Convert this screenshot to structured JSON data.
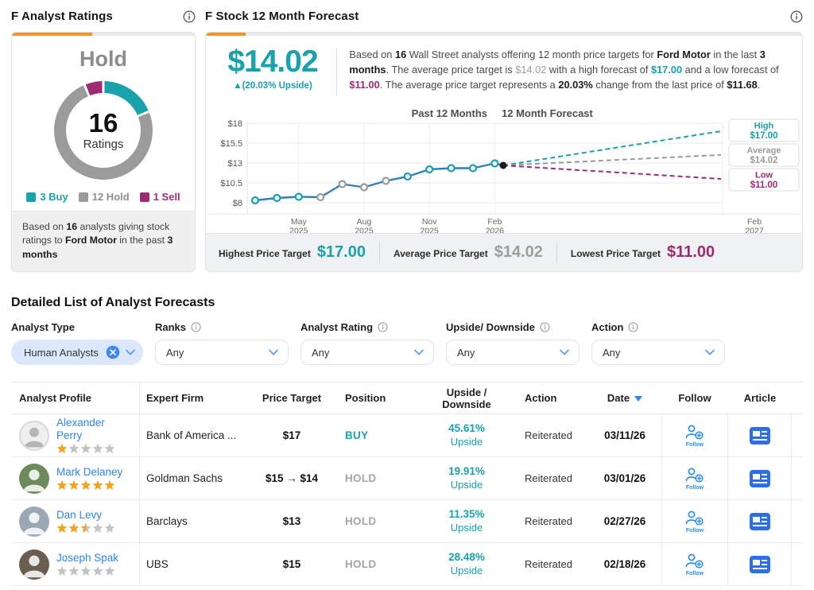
{
  "colors": {
    "teal": "#17a2ac",
    "magenta": "#a02a72",
    "muted": "#9e9e9e",
    "orange": "#f7941e",
    "line_blue": "#2f7fbd",
    "link_blue": "#2e87e5",
    "icon_blue": "#2b8ff0",
    "article_blue": "#2a6fe8",
    "hold_gray": "#9b9b9b"
  },
  "ratings_panel": {
    "title": "F Analyst Ratings",
    "consensus": "Hold",
    "count": "16",
    "count_label": "Ratings",
    "segments": [
      {
        "label": "3 Buy",
        "count": 3,
        "color": "#17a2ac",
        "text_color": "#17a2ac"
      },
      {
        "label": "12 Hold",
        "count": 12,
        "color": "#9b9b9b",
        "text_color": "#8e8e8e"
      },
      {
        "label": "1 Sell",
        "count": 1,
        "color": "#a02a72",
        "text_color": "#a02a72"
      }
    ],
    "footnote": [
      {
        "t": "Based on "
      },
      {
        "t": "16",
        "b": true
      },
      {
        "t": " analysts giving stock ratings to "
      },
      {
        "t": "Ford Motor",
        "b": true
      },
      {
        "t": " in the past "
      },
      {
        "t": "3 months",
        "b": true
      }
    ]
  },
  "forecast_panel": {
    "title": "F Stock 12 Month Forecast",
    "avg_price": "$14.02",
    "upside_caption": "▲(20.03% Upside)",
    "description": [
      {
        "t": "Based on "
      },
      {
        "t": "16",
        "b": true
      },
      {
        "t": " Wall Street analysts offering 12 month price targets for "
      },
      {
        "t": "Ford Motor",
        "b": true
      },
      {
        "t": " in the last "
      },
      {
        "t": "3 months",
        "b": true
      },
      {
        "t": ". The average price target is "
      },
      {
        "t": "$14.02",
        "c": "muted"
      },
      {
        "t": " with a high forecast of "
      },
      {
        "t": "$17.00",
        "b": true,
        "c": "teal"
      },
      {
        "t": " and a low forecast of "
      },
      {
        "t": "$11.00",
        "b": true,
        "c": "magenta"
      },
      {
        "t": ". The average price target represents a "
      },
      {
        "t": "20.03%",
        "b": true
      },
      {
        "t": " change from the last price of "
      },
      {
        "t": "$11.68",
        "b": true
      },
      {
        "t": "."
      }
    ],
    "chart_data": {
      "type": "line",
      "series_label_past": "Past 12 Months",
      "series_label_forecast": "12 Month Forecast",
      "ylim": [
        8,
        18
      ],
      "y_ticks": [
        {
          "label": "$18",
          "v": 18
        },
        {
          "label": "$15.5",
          "v": 15.5
        },
        {
          "label": "$13",
          "v": 13
        },
        {
          "label": "$10.5",
          "v": 10.5
        },
        {
          "label": "$8",
          "v": 8
        }
      ],
      "x_ticks": [
        {
          "i": 2,
          "month": "May",
          "year": "2025"
        },
        {
          "i": 5,
          "month": "Aug",
          "year": "2025"
        },
        {
          "i": 8,
          "month": "Nov",
          "year": "2025"
        },
        {
          "i": 11,
          "month": "Feb",
          "year": "2026"
        }
      ],
      "forecast_x_tick": {
        "month": "Feb",
        "year": "2027"
      },
      "price_history": [
        {
          "v": 8.3,
          "marker": "teal"
        },
        {
          "v": 8.6,
          "marker": "teal"
        },
        {
          "v": 8.75,
          "marker": "teal"
        },
        {
          "v": 8.7,
          "marker": "gray"
        },
        {
          "v": 10.35,
          "marker": "gray"
        },
        {
          "v": 9.95,
          "marker": "gray"
        },
        {
          "v": 10.75,
          "marker": "gray"
        },
        {
          "v": 11.3,
          "marker": "teal"
        },
        {
          "v": 12.2,
          "marker": "teal"
        },
        {
          "v": 12.35,
          "marker": "teal"
        },
        {
          "v": 12.35,
          "marker": "teal"
        },
        {
          "v": 12.95,
          "marker": "teal"
        }
      ],
      "last_point": {
        "v": 12.7
      },
      "forecast_lines": [
        {
          "name": "High",
          "value": "$17.00",
          "v": 17,
          "color_key": "teal"
        },
        {
          "name": "Average",
          "value": "$14.02",
          "v": 14.02,
          "color_key": "muted"
        },
        {
          "name": "Low",
          "value": "$11.00",
          "v": 11,
          "color_key": "magenta"
        }
      ]
    },
    "targets_bar": [
      {
        "label": "Highest Price Target",
        "value": "$17.00",
        "color_key": "teal"
      },
      {
        "label": "Average Price Target",
        "value": "$14.02",
        "color_key": "muted"
      },
      {
        "label": "Lowest Price Target",
        "value": "$11.00",
        "color_key": "magenta"
      }
    ]
  },
  "detailed_section": {
    "title": "Detailed List of Analyst Forecasts",
    "filters": [
      {
        "label": "Analyst Type",
        "info": false,
        "type": "chip",
        "value": "Human Analysts"
      },
      {
        "label": "Ranks",
        "info": true,
        "type": "select",
        "value": "Any"
      },
      {
        "label": "Analyst Rating",
        "info": true,
        "type": "select",
        "value": "Any"
      },
      {
        "label": "Upside/ Downside",
        "info": true,
        "type": "select",
        "value": "Any"
      },
      {
        "label": "Action",
        "info": true,
        "type": "select",
        "value": "Any"
      }
    ],
    "table": {
      "headers": [
        {
          "key": "profile",
          "label": "Analyst Profile"
        },
        {
          "key": "firm",
          "label": "Expert Firm"
        },
        {
          "key": "pt",
          "label": "Price Target"
        },
        {
          "key": "pos",
          "label": "Position"
        },
        {
          "key": "ud",
          "label": "Upside / Downside"
        },
        {
          "key": "action",
          "label": "Action"
        },
        {
          "key": "date",
          "label": "Date",
          "sorted": "desc"
        },
        {
          "key": "follow",
          "label": "Follow"
        },
        {
          "key": "article",
          "label": "Article"
        }
      ],
      "follow_button_label": "Follow",
      "rows": [
        {
          "analyst": "Alexander Perry",
          "stars": 1,
          "avatar": "placeholder",
          "firm": "Bank of America ...",
          "price_target": "$17",
          "position": "BUY",
          "position_type": "buy",
          "change": "45.61%",
          "direction": "Upside",
          "action": "Reiterated",
          "date": "03/11/26"
        },
        {
          "analyst": "Mark Delaney",
          "stars": 5,
          "avatar": "photo-green",
          "firm": "Goldman Sachs",
          "price_target": "$15 → $14",
          "position": "HOLD",
          "position_type": "hold",
          "change": "19.91%",
          "direction": "Upside",
          "action": "Reiterated",
          "date": "03/01/26"
        },
        {
          "analyst": "Dan Levy",
          "stars": 2.5,
          "avatar": "photo-light",
          "firm": "Barclays",
          "price_target": "$13",
          "position": "HOLD",
          "position_type": "hold",
          "change": "11.35%",
          "direction": "Upside",
          "action": "Reiterated",
          "date": "02/27/26"
        },
        {
          "analyst": "Joseph Spak",
          "stars": 0,
          "avatar": "photo-dark",
          "firm": "UBS",
          "price_target": "$15",
          "position": "HOLD",
          "position_type": "hold",
          "change": "28.48%",
          "direction": "Upside",
          "action": "Reiterated",
          "date": "02/18/26"
        }
      ]
    }
  }
}
